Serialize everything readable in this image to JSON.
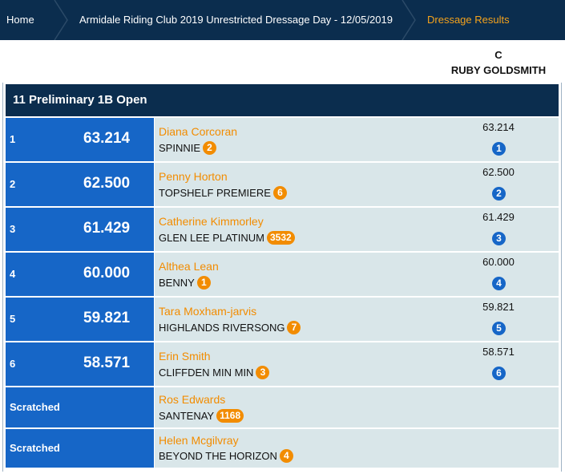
{
  "breadcrumb": {
    "items": [
      "Home",
      "Armidale Riding Club 2019 Unrestricted Dressage Day - 12/05/2019",
      "Dressage Results"
    ]
  },
  "judge": {
    "position": "C",
    "name": "RUBY GOLDSMITH"
  },
  "class_title": "11 Preliminary 1B Open",
  "results": [
    {
      "place": "1",
      "score": "63.214",
      "rider": "Diana Corcoran",
      "horse": "SPINNIE",
      "horse_no": "2",
      "judge_score": "63.214",
      "judge_rank": "1"
    },
    {
      "place": "2",
      "score": "62.500",
      "rider": "Penny Horton",
      "horse": "TOPSHELF PREMIERE",
      "horse_no": "6",
      "judge_score": "62.500",
      "judge_rank": "2"
    },
    {
      "place": "3",
      "score": "61.429",
      "rider": "Catherine Kimmorley",
      "horse": "GLEN LEE PLATINUM",
      "horse_no": "3532",
      "judge_score": "61.429",
      "judge_rank": "3"
    },
    {
      "place": "4",
      "score": "60.000",
      "rider": "Althea Lean",
      "horse": "BENNY",
      "horse_no": "1",
      "judge_score": "60.000",
      "judge_rank": "4"
    },
    {
      "place": "5",
      "score": "59.821",
      "rider": "Tara Moxham-jarvis",
      "horse": "HIGHLANDS RIVERSONG",
      "horse_no": "7",
      "judge_score": "59.821",
      "judge_rank": "5"
    },
    {
      "place": "6",
      "score": "58.571",
      "rider": "Erin Smith",
      "horse": "CLIFFDEN MIN MIN",
      "horse_no": "3",
      "judge_score": "58.571",
      "judge_rank": "6"
    }
  ],
  "scratched": [
    {
      "label": "Scratched",
      "rider": "Ros Edwards",
      "horse": "SANTENAY",
      "horse_no": "1168"
    },
    {
      "label": "Scratched",
      "rider": "Helen Mcgilvray",
      "horse": "BEYOND THE HORIZON",
      "horse_no": "4"
    }
  ],
  "colors": {
    "nav_bg": "#0b2d4e",
    "rank_bg": "#1666c7",
    "row_bg": "#d9e6e9",
    "accent": "#f28c00",
    "active_crumb": "#f4a21c"
  }
}
